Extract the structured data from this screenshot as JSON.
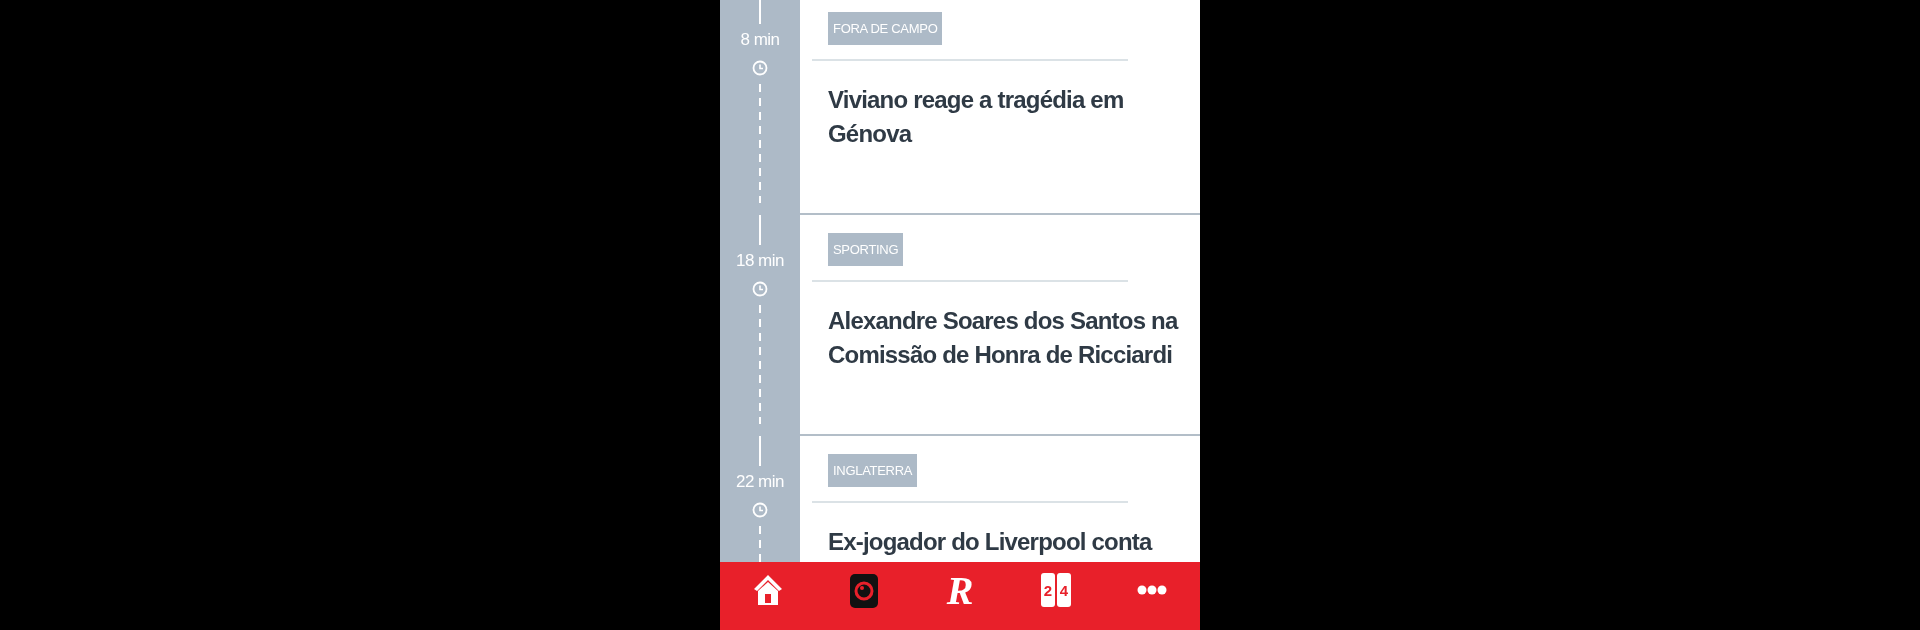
{
  "feed": [
    {
      "time": "8 min",
      "tag": "FORA DE CAMPO",
      "headline": "Viviano reage a tragédia em Génova"
    },
    {
      "time": "18 min",
      "tag": "SPORTING",
      "headline": "Alexandre Soares dos Santos na Comissão de Honra de Ricciardi"
    },
    {
      "time": "22 min",
      "tag": "INGLATERRA",
      "headline": "Ex-jogador do Liverpool conta"
    }
  ],
  "bottom_nav": [
    {
      "kind": "home"
    },
    {
      "kind": "live"
    },
    {
      "kind": "logo",
      "glyph": "R"
    },
    {
      "kind": "scores",
      "digits": [
        "2",
        "4"
      ]
    },
    {
      "kind": "more"
    }
  ]
}
